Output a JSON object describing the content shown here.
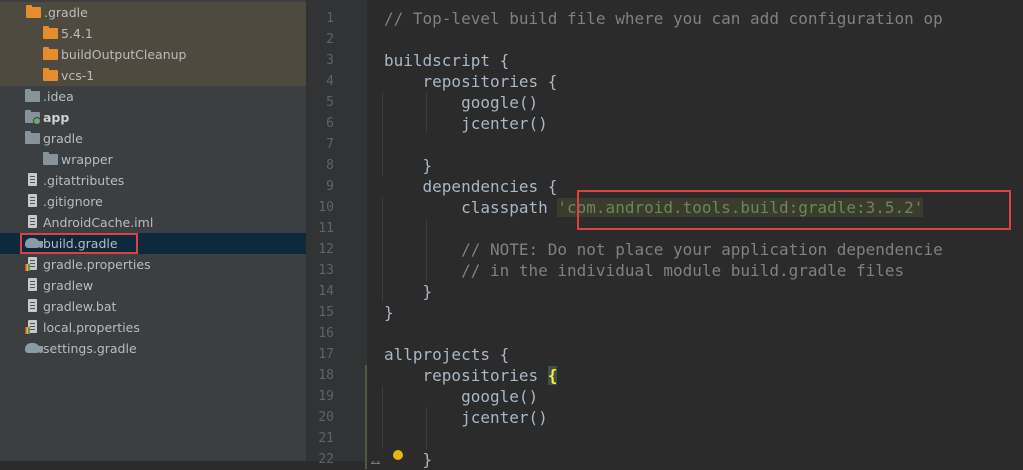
{
  "project_tree": {
    "items": [
      {
        "label": ".gradle",
        "arrow": "▼",
        "icon": "folder-orange-icon",
        "excluded": true
      },
      {
        "label": "5.4.1",
        "arrow": "▶",
        "icon": "folder-orange-icon",
        "excluded": true
      },
      {
        "label": "buildOutputCleanup",
        "arrow": "▶",
        "icon": "folder-orange-icon",
        "excluded": true
      },
      {
        "label": "vcs-1",
        "arrow": "▶",
        "icon": "folder-orange-icon",
        "excluded": true
      },
      {
        "label": ".idea",
        "arrow": "▶",
        "icon": "folder-icon"
      },
      {
        "label": "app",
        "arrow": "▶",
        "icon": "module-folder-icon"
      },
      {
        "label": "gradle",
        "arrow": "▼",
        "icon": "folder-icon"
      },
      {
        "label": "wrapper",
        "arrow": "▶",
        "icon": "folder-icon"
      },
      {
        "label": ".gitattributes",
        "icon": "text-file-icon"
      },
      {
        "label": ".gitignore",
        "icon": "text-file-icon"
      },
      {
        "label": "AndroidCache.iml",
        "icon": "text-file-icon"
      },
      {
        "label": "build.gradle",
        "icon": "gradle-elephant-icon",
        "selected": true
      },
      {
        "label": "gradle.properties",
        "icon": "properties-file-icon"
      },
      {
        "label": "gradlew",
        "icon": "text-file-icon"
      },
      {
        "label": "gradlew.bat",
        "icon": "text-file-icon"
      },
      {
        "label": "local.properties",
        "icon": "properties-file-icon"
      },
      {
        "label": "settings.gradle",
        "icon": "gradle-elephant-icon"
      }
    ]
  },
  "editor": {
    "line_numbers": [
      "1",
      "2",
      "3",
      "4",
      "5",
      "6",
      "7",
      "8",
      "9",
      "10",
      "11",
      "12",
      "13",
      "14",
      "15",
      "16",
      "17",
      "18",
      "19",
      "20",
      "21",
      "22"
    ],
    "lines": [
      "// Top-level build file where you can add configuration op",
      "",
      "buildscript {",
      "    repositories {",
      "        google()",
      "        jcenter()",
      "",
      "    }",
      "    dependencies {",
      "        classpath ",
      "",
      "        // NOTE: Do not place your application dependencie",
      "        // in the individual module build.gradle files",
      "    }",
      "}",
      "",
      "allprojects {",
      "    repositories ",
      "        google()",
      "        jcenter()",
      "",
      "    }"
    ],
    "classpath_string": "'com.android.tools.build:gradle:3.5.2'",
    "highlighted_brace": "{"
  },
  "colors": {
    "highlight_box": "#e04040",
    "tree_bg": "#3c3f41",
    "editor_bg": "#2b2b2b",
    "excluded_bg": "#4e4a3f",
    "selected_bg": "#0d293e"
  }
}
